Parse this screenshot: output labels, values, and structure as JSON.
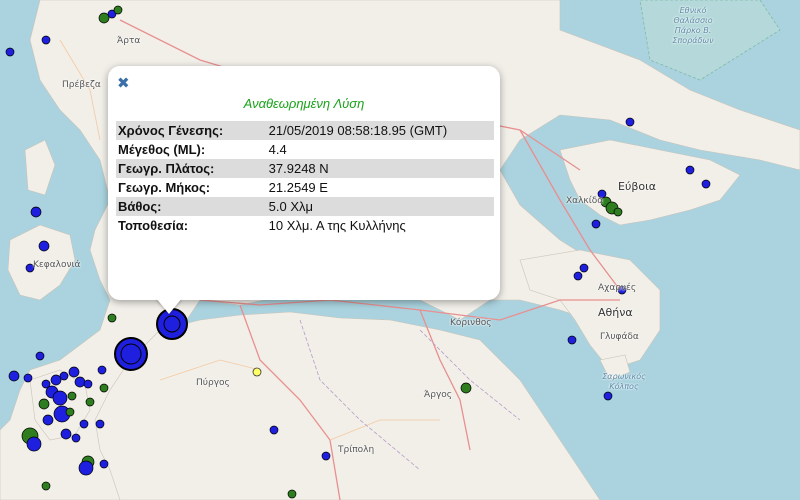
{
  "popup": {
    "close_icon": "close-icon",
    "title": "Αναθεωρημένη Λύση",
    "rows": [
      {
        "label": "Χρόνος Γένεσης:",
        "value": "21/05/2019 08:58:18.95 (GMT)"
      },
      {
        "label": "Μέγεθος (ML):",
        "value": "4.4"
      },
      {
        "label": "Γεωγρ. Πλάτος:",
        "value": "37.9248 N"
      },
      {
        "label": "Γεωγρ. Μήκος:",
        "value": "21.2549 E"
      },
      {
        "label": "Βάθος:",
        "value": "5.0 Χλμ"
      },
      {
        "label": "Τοποθεσία:",
        "value": "10 Χλμ. Α της Κυλλήνης"
      }
    ]
  },
  "places": {
    "arta": "Άρτα",
    "preveza": "Πρέβεζα",
    "kefalonia": "Κεφαλονιά",
    "evia": "Εύβοια",
    "chalkida": "Χαλκίδα",
    "athina": "Αθήνα",
    "korinthos": "Κόρινθος",
    "pyrgos": "Πύργος",
    "argos": "Άργος",
    "tripoli": "Τρίπολη",
    "glyfada": "Γλυφάδα",
    "saronikos": "Σαρωνικός Κόλπος",
    "acharnes": "Αχαρνές",
    "marine_park": "Εθνικό Θαλάσσιο Πάρκο Β. Σποράδων"
  },
  "colors": {
    "sea": "#aad3df",
    "land": "#f2efe9",
    "recent_event": "#1f1fe0",
    "older_event": "#2e7d1f",
    "latest_event": "#ffff66",
    "popup_title": "#1aa31a"
  }
}
